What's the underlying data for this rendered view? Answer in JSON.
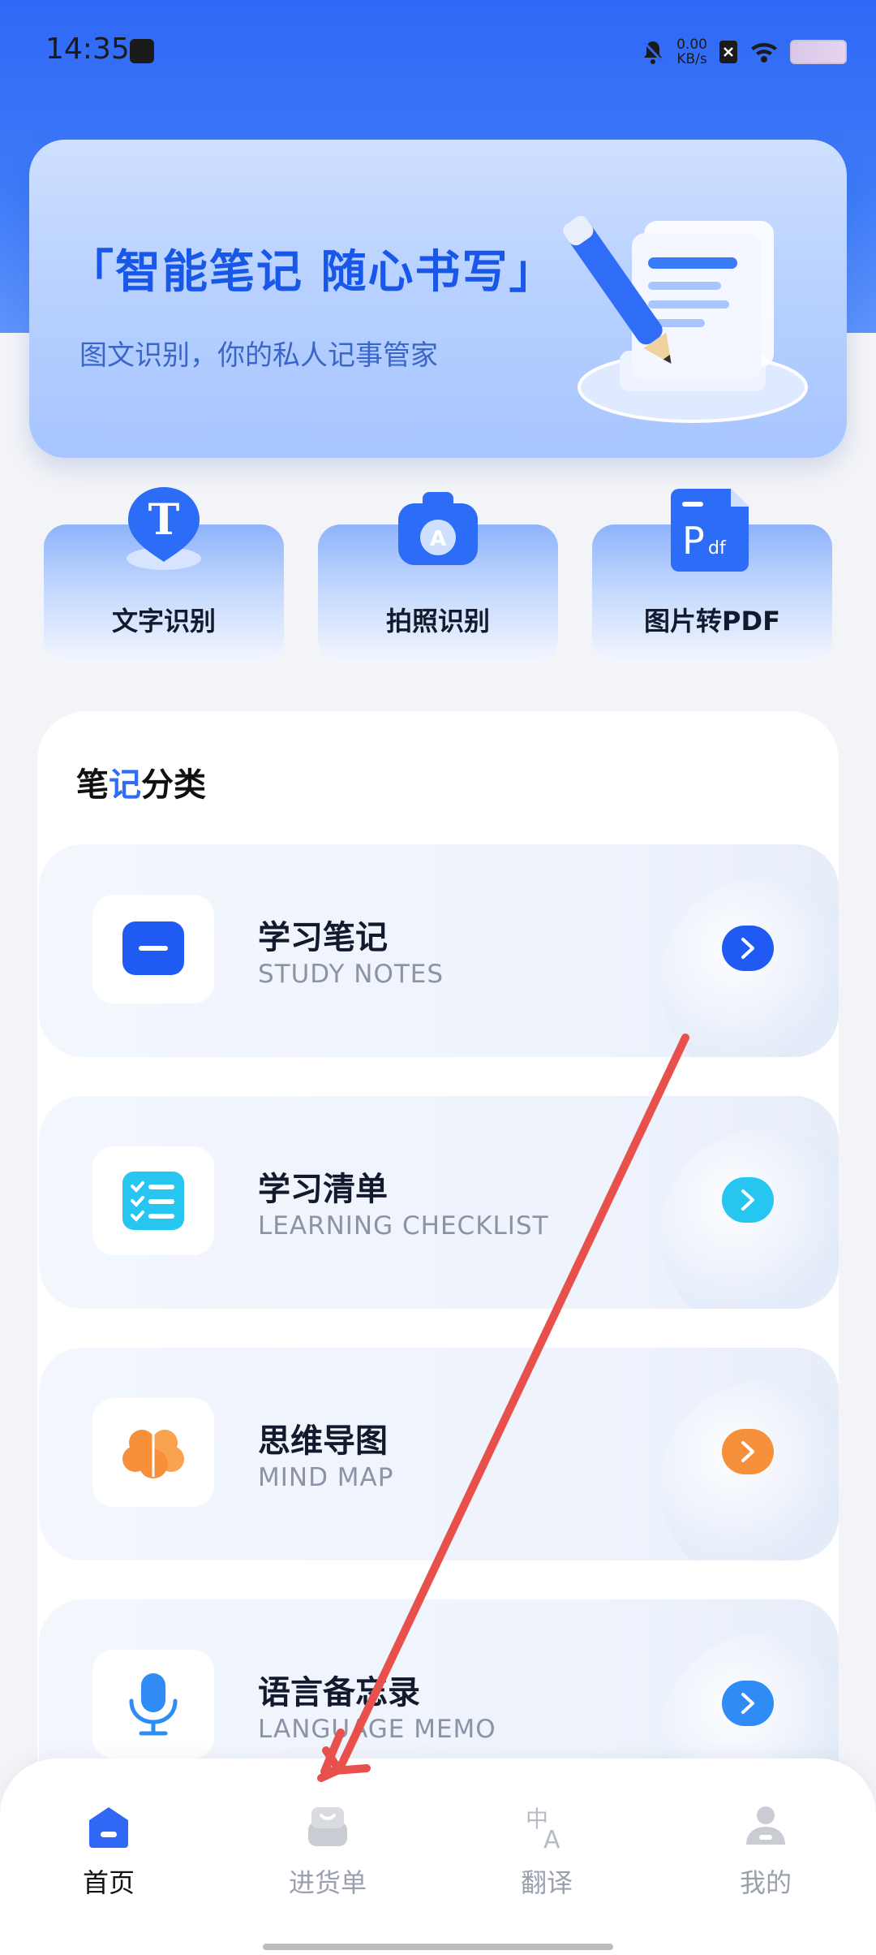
{
  "status_bar": {
    "time": "14:35",
    "net_speed_value": "0.00",
    "net_speed_unit": "KB/s"
  },
  "banner": {
    "title": "「智能笔记 随心书写」",
    "subtitle": "图文识别，你的私人记事管家"
  },
  "tools": [
    {
      "label": "文字识别",
      "icon": "text-recognition-icon",
      "glyph": "T"
    },
    {
      "label": "拍照识别",
      "icon": "camera-icon",
      "glyph": "A"
    },
    {
      "label": "图片转PDF",
      "icon": "pdf-icon",
      "glyph": "P",
      "glyph_small": "df"
    }
  ],
  "categories": {
    "title_part1": "笔",
    "title_part2": "记",
    "title_part3": "分类",
    "items": [
      {
        "title": "学习笔记",
        "subtitle": "STUDY NOTES",
        "icon": "note-icon",
        "accent": "#1f5af2"
      },
      {
        "title": "学习清单",
        "subtitle": "LEARNING CHECKLIST",
        "icon": "checklist-icon",
        "accent": "#26c6f0"
      },
      {
        "title": "思维导图",
        "subtitle": "MIND MAP",
        "icon": "brain-icon",
        "accent": "#f7903a"
      },
      {
        "title": "语言备忘录",
        "subtitle": "LANGUAGE MEMO",
        "icon": "microphone-icon",
        "accent": "#2f8cf5"
      }
    ]
  },
  "bottom_nav": [
    {
      "label": "首页",
      "icon": "home-icon",
      "active": true
    },
    {
      "label": "进货单",
      "icon": "purchase-order-icon",
      "active": false
    },
    {
      "label": "翻译",
      "icon": "translate-icon",
      "active": false
    },
    {
      "label": "我的",
      "icon": "profile-icon",
      "active": false
    }
  ],
  "colors": {
    "primary": "#2f68f5",
    "annotation_arrow": "#e8504c"
  }
}
